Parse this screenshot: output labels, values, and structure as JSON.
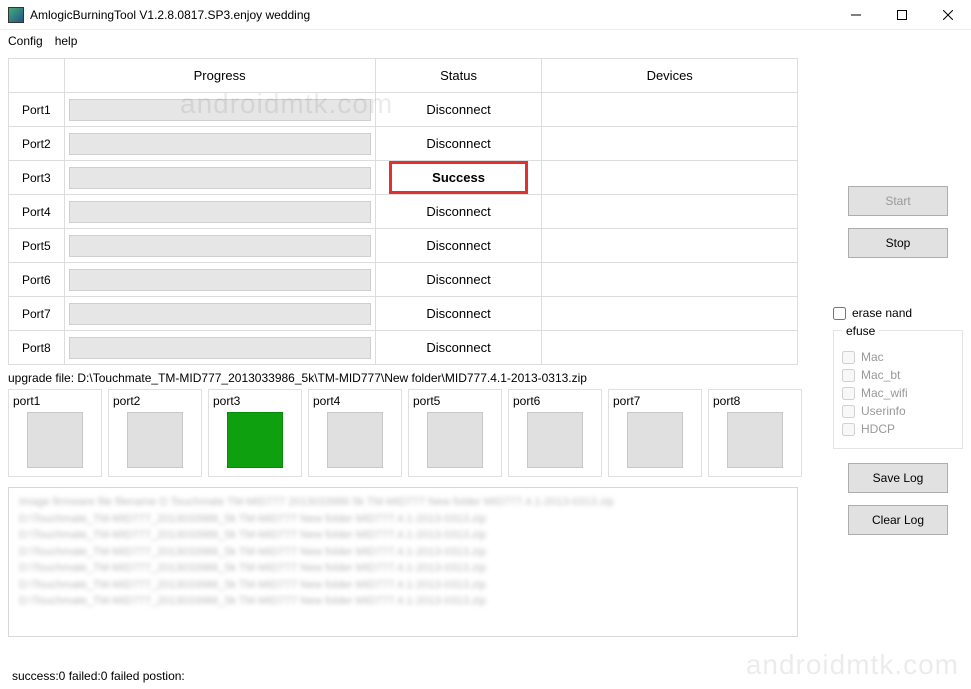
{
  "window": {
    "title": "AmlogicBurningTool  V1.2.8.0817.SP3.enjoy wedding"
  },
  "menu": {
    "config": "Config",
    "help": "help"
  },
  "table": {
    "headers": {
      "progress": "Progress",
      "status": "Status",
      "devices": "Devices"
    },
    "rows": [
      {
        "label": "Port1",
        "status": "Disconnect",
        "success": false
      },
      {
        "label": "Port2",
        "status": "Disconnect",
        "success": false
      },
      {
        "label": "Port3",
        "status": "Success",
        "success": true
      },
      {
        "label": "Port4",
        "status": "Disconnect",
        "success": false
      },
      {
        "label": "Port5",
        "status": "Disconnect",
        "success": false
      },
      {
        "label": "Port6",
        "status": "Disconnect",
        "success": false
      },
      {
        "label": "Port7",
        "status": "Disconnect",
        "success": false
      },
      {
        "label": "Port8",
        "status": "Disconnect",
        "success": false
      }
    ]
  },
  "upgrade_file": "upgrade file: D:\\Touchmate_TM-MID777_2013033986_5k\\TM-MID777\\New folder\\MID777.4.1-2013-0313.zip",
  "port_panels": [
    {
      "label": "port1",
      "success": false
    },
    {
      "label": "port2",
      "success": false
    },
    {
      "label": "port3",
      "success": true
    },
    {
      "label": "port4",
      "success": false
    },
    {
      "label": "port5",
      "success": false
    },
    {
      "label": "port6",
      "success": false
    },
    {
      "label": "port7",
      "success": false
    },
    {
      "label": "port8",
      "success": false
    }
  ],
  "log_lines": [
    "Image firmware file     filename D Touchmate  TM-MID777  2013033986  5k TM-MID777 New folder MID777.4.1-2013-0313.zip",
    "D:\\Touchmate_TM-MID777_2013033986_5k TM-MID777 New folder MID777.4.1-2013-0313.zip",
    "D:\\Touchmate_TM-MID777_2013033986_5k TM-MID777 New folder MID777.4.1-2013-0313.zip",
    "D:\\Touchmate_TM-MID777_2013033986_5k TM-MID777 New folder MID777.4.1-2013-0313.zip",
    "D:\\Touchmate_TM-MID777_2013033986_5k TM-MID777 New folder MID777.4.1-2013-0313.zip",
    "D:\\Touchmate_TM-MID777_2013033986_5k TM-MID777 New folder MID777.4.1-2013-0313.zip",
    "D:\\Touchmate_TM-MID777_2013033986_5k TM-MID777 New folder MID777.4.1-2013-0313.zip"
  ],
  "buttons": {
    "start": "Start",
    "stop": "Stop",
    "save_log": "Save Log",
    "clear_log": "Clear Log"
  },
  "checkboxes": {
    "erase_nand": "erase nand",
    "efuse_legend": "efuse",
    "mac": "Mac",
    "mac_bt": "Mac_bt",
    "mac_wifi": "Mac_wifi",
    "userinfo": "Userinfo",
    "hdcp": "HDCP"
  },
  "status_bar": "success:0 failed:0 failed postion:",
  "watermark": "androidmtk.com"
}
